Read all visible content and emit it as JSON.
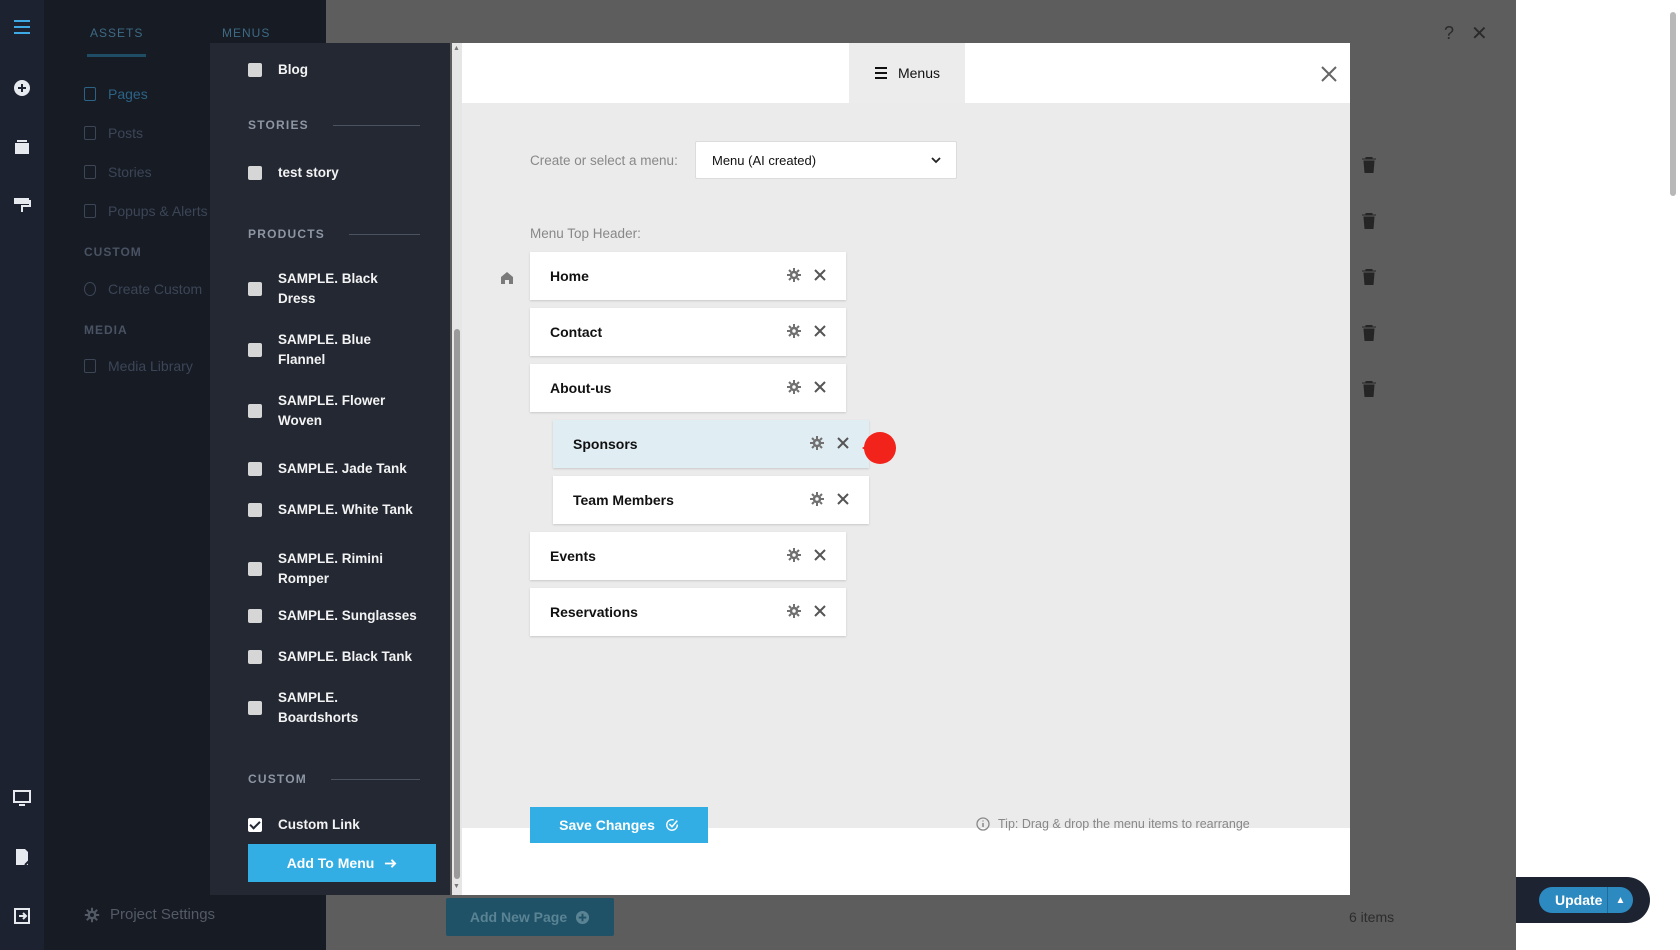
{
  "rail": {
    "icons": [
      "hamburger-icon",
      "add-circle-icon",
      "layers-icon",
      "paint-roller-icon",
      "monitor-icon",
      "page-edit-icon",
      "exit-icon"
    ]
  },
  "assets_panel": {
    "tabs": [
      "ASSETS",
      "MENUS"
    ],
    "items": [
      "Pages",
      "Posts",
      "Stories",
      "Popups & Alerts"
    ],
    "custom_heading": "CUSTOM",
    "custom_item": "Create Custom",
    "media_heading": "MEDIA",
    "media_item": "Media Library",
    "project_settings": "Project Settings"
  },
  "background": {
    "add_new_page": "Add New Page",
    "items_count": "6 items",
    "update_label": "Update"
  },
  "picker": {
    "blog": "Blog",
    "stories_heading": "STORIES",
    "stories": [
      "test story"
    ],
    "products_heading": "PRODUCTS",
    "products": [
      "SAMPLE. Black Dress",
      "SAMPLE. Blue Flannel",
      "SAMPLE. Flower Woven",
      "SAMPLE. Jade Tank",
      "SAMPLE. White Tank",
      "SAMPLE. Rimini Romper",
      "SAMPLE. Sunglasses",
      "SAMPLE. Black Tank",
      "SAMPLE. Boardshorts"
    ],
    "custom_heading": "CUSTOM",
    "custom_link": "Custom Link",
    "custom_link_checked": true,
    "add_to_menu": "Add To Menu"
  },
  "modal": {
    "tab_label": "Menus",
    "select_label": "Create or select a menu:",
    "select_value": "Menu (AI created)",
    "menu_header_label": "Menu Top Header:",
    "menu_items": [
      {
        "label": "Home",
        "level": 0,
        "home": true
      },
      {
        "label": "Contact",
        "level": 0
      },
      {
        "label": "About-us",
        "level": 0
      },
      {
        "label": "Sponsors",
        "level": 1,
        "highlighted": true
      },
      {
        "label": "Team Members",
        "level": 1
      },
      {
        "label": "Events",
        "level": 0
      },
      {
        "label": "Reservations",
        "level": 0
      }
    ],
    "save_changes": "Save Changes",
    "tip": "Tip: Drag & drop the menu items to rearrange"
  },
  "colors": {
    "accent": "#33aee4",
    "rail": "#1c2230",
    "picker_bg": "#232833",
    "cursor": "#f2231a"
  }
}
